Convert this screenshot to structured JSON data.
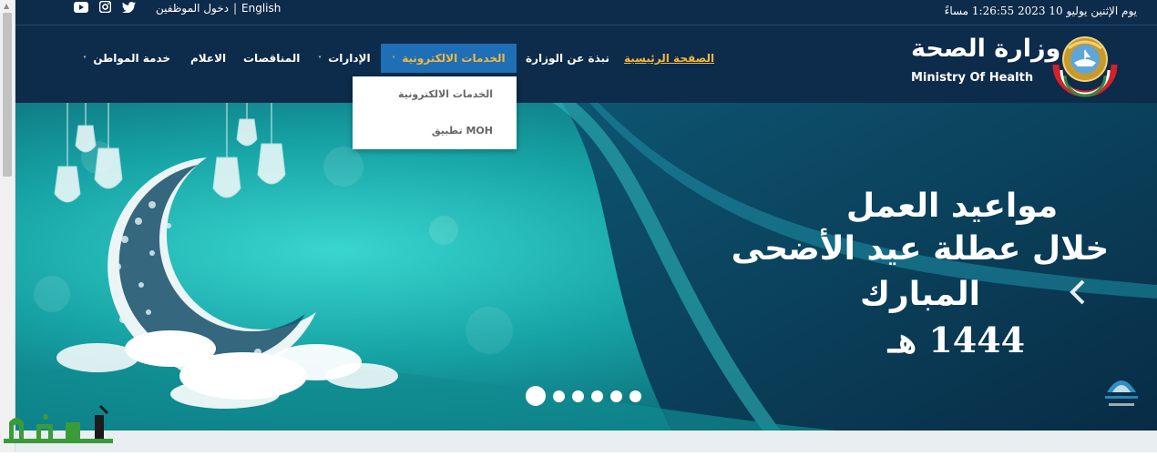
{
  "topbar": {
    "datetime": "يوم الإثنين يوليو 10 2023 1:26:55 مساءً",
    "english_link": "English",
    "separator": "|",
    "staff_login": "دخول الموظفين",
    "social_icons": [
      "twitter-icon",
      "instagram-icon",
      "youtube-icon"
    ]
  },
  "header": {
    "logo_arabic": "وزارة الصحة",
    "logo_english": "Ministry Of Health"
  },
  "nav": {
    "items": [
      {
        "label": "الصفحة الرئيسية",
        "has_dropdown": false,
        "state": "current"
      },
      {
        "label": "نبذة عن الوزارة",
        "has_dropdown": false
      },
      {
        "label": "الخدمات الالكترونية",
        "has_dropdown": true,
        "state": "open"
      },
      {
        "label": "الإدارات",
        "has_dropdown": true
      },
      {
        "label": "المناقصات",
        "has_dropdown": false
      },
      {
        "label": "الاعلام",
        "has_dropdown": false
      },
      {
        "label": "خدمة المواطن",
        "has_dropdown": true
      }
    ],
    "chevron": "˅"
  },
  "dropdown": {
    "items": [
      "الخدمات الالكترونية",
      "تطبيق MOH"
    ]
  },
  "hero": {
    "line1": "مواعيد العمل",
    "line2": "خلال عطلة عيد الأضحى المبارك",
    "line3": "1444 هـ",
    "active_slide": 1,
    "slide_count": 6
  },
  "colors": {
    "navy": "#0d2b4a",
    "accent_gold": "#f2b840",
    "active_blue": "#1f6fb6",
    "hero_teal": "#1aa0a8"
  }
}
